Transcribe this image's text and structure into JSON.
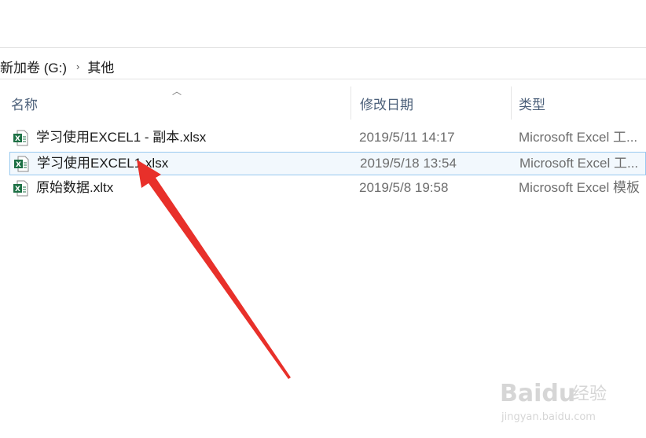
{
  "breadcrumb": {
    "drive": "新加卷 (G:)",
    "separator": "›",
    "folder": "其他"
  },
  "columns": {
    "name": "名称",
    "date": "修改日期",
    "type": "类型"
  },
  "files": [
    {
      "name": "学习使用EXCEL1 - 副本.xlsx",
      "date": "2019/5/11 14:17",
      "type": "Microsoft Excel 工...",
      "selected": false
    },
    {
      "name": "学习使用EXCEL1.xlsx",
      "date": "2019/5/18 13:54",
      "type": "Microsoft Excel 工...",
      "selected": true
    },
    {
      "name": "原始数据.xltx",
      "date": "2019/5/8 19:58",
      "type": "Microsoft Excel 模板",
      "selected": false
    }
  ],
  "colors": {
    "accent_arrow": "#e8302a",
    "selection_border": "#99c9ef",
    "excel_green": "#1d7044"
  },
  "watermark": {
    "brand": "Baidu",
    "brand_cn": "经验",
    "url": "jingyan.baidu.com"
  }
}
